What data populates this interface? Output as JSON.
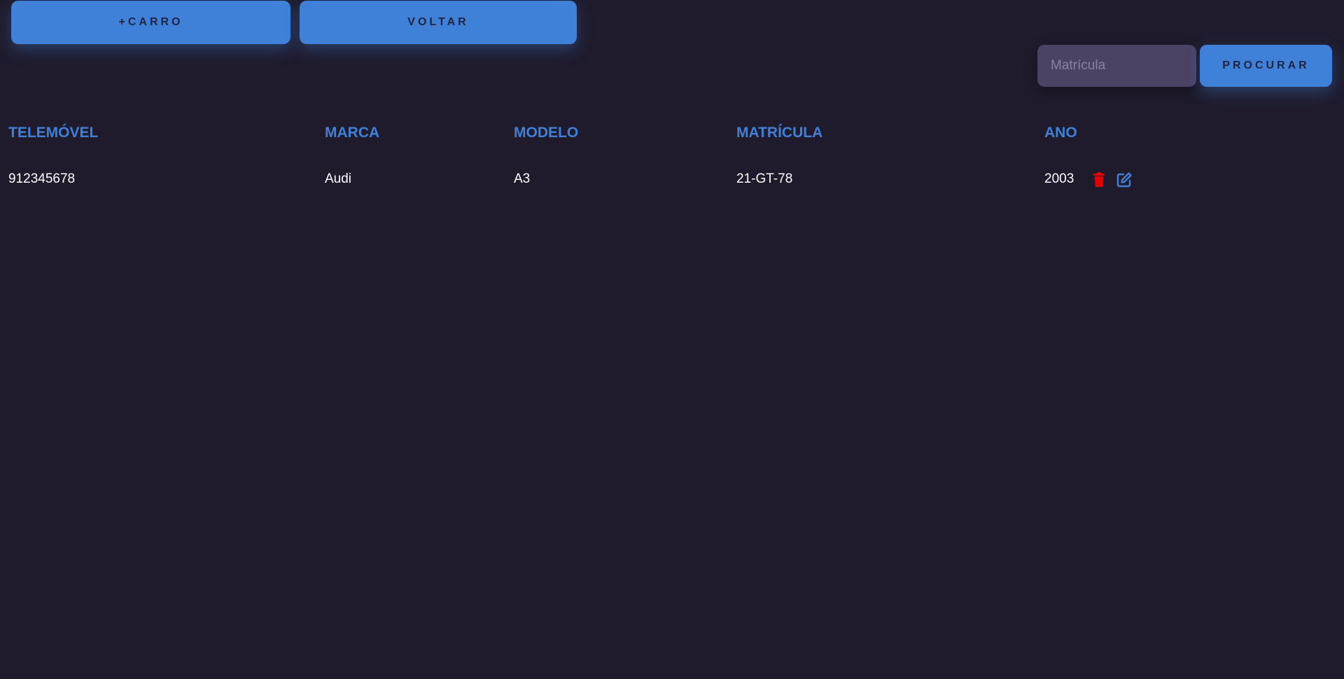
{
  "toolbar": {
    "add_car_label": "+CARRO",
    "back_label": "VOLTAR"
  },
  "search": {
    "placeholder": "Matrícula",
    "value": "",
    "button_label": "PROCURAR"
  },
  "table": {
    "columns": [
      "TELEMÓVEL",
      "MARCA",
      "MODELO",
      "MATRÍCULA",
      "ANO"
    ],
    "rows": [
      {
        "telemovel": "912345678",
        "marca": "Audi",
        "modelo": "A3",
        "matricula": "21-GT-78",
        "ano": "2003",
        "actions": [
          "trash-icon",
          "edit-icon"
        ]
      }
    ]
  },
  "colors": {
    "background": "#1f1b2d",
    "accent": "#3f80d8",
    "button_text": "#1f2540",
    "input_background": "#4b4264",
    "delete": "#e00000",
    "text": "#ffffff"
  }
}
